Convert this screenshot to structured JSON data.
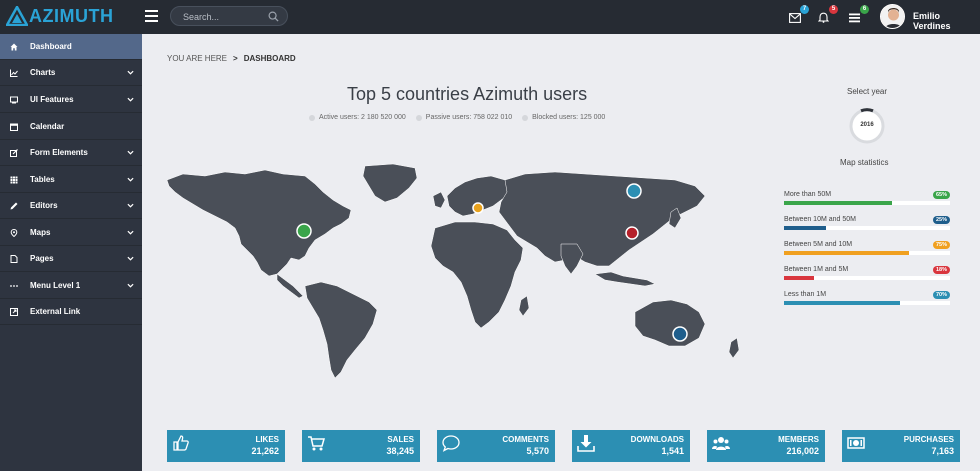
{
  "app": {
    "logo_text": "AZIMUTH"
  },
  "search": {
    "placeholder": "Search..."
  },
  "topbar": {
    "mail_badge": "7",
    "notif_badge": "5",
    "tasks_badge": "6",
    "user_name": "Emilio Verdines",
    "colors": {
      "mail": "#2aa3d6",
      "notif": "#d9363e",
      "tasks": "#3aa54a"
    }
  },
  "sidebar": {
    "items": [
      {
        "label": "Dashboard",
        "icon": "home-icon",
        "active": true,
        "has_children": false
      },
      {
        "label": "Charts",
        "icon": "chart-icon",
        "active": false,
        "has_children": true
      },
      {
        "label": "UI Features",
        "icon": "monitor-icon",
        "active": false,
        "has_children": true
      },
      {
        "label": "Calendar",
        "icon": "calendar-icon",
        "active": false,
        "has_children": false
      },
      {
        "label": "Form Elements",
        "icon": "edit-icon",
        "active": false,
        "has_children": true
      },
      {
        "label": "Tables",
        "icon": "grid-icon",
        "active": false,
        "has_children": true
      },
      {
        "label": "Editors",
        "icon": "pencil-icon",
        "active": false,
        "has_children": true
      },
      {
        "label": "Maps",
        "icon": "map-marker-icon",
        "active": false,
        "has_children": true
      },
      {
        "label": "Pages",
        "icon": "file-icon",
        "active": false,
        "has_children": true
      },
      {
        "label": "Menu Level 1",
        "icon": "ellipsis-icon",
        "active": false,
        "has_children": true
      },
      {
        "label": "External Link",
        "icon": "external-link-icon",
        "active": false,
        "has_children": false
      }
    ]
  },
  "breadcrumb": {
    "prefix": "YOU ARE HERE",
    "separator": ">",
    "current": "DASHBOARD"
  },
  "map": {
    "title": "Top 5 countries Azimuth users",
    "legend": [
      {
        "label": "Active users: 2 180 520 000"
      },
      {
        "label": "Passive users: 758 022 010"
      },
      {
        "label": "Blocked users: 125 000"
      }
    ],
    "markers": [
      {
        "region": "North America",
        "color": "#3aa54a"
      },
      {
        "region": "Europe",
        "color": "#e8a21e"
      },
      {
        "region": "Russia",
        "color": "#2c8fb3"
      },
      {
        "region": "China",
        "color": "#b5202a"
      },
      {
        "region": "Australia",
        "color": "#1f5e8c"
      }
    ]
  },
  "year": {
    "label": "Select year",
    "value": "2016"
  },
  "map_stats": {
    "title": "Map statistics",
    "rows": [
      {
        "label": "More than 50M",
        "percent": 65,
        "badge": "65%",
        "color": "#3aa54a"
      },
      {
        "label": "Between 10M and 50M",
        "percent": 25,
        "badge": "25%",
        "color": "#1f5e8c"
      },
      {
        "label": "Between 5M and 10M",
        "percent": 75,
        "badge": "75%",
        "color": "#f0a020"
      },
      {
        "label": "Between 1M and 5M",
        "percent": 18,
        "badge": "18%",
        "color": "#d9363e"
      },
      {
        "label": "Less than 1M",
        "percent": 70,
        "badge": "70%",
        "color": "#2c8fb3"
      }
    ]
  },
  "tiles": [
    {
      "label": "LIKES",
      "value": "21,262",
      "icon": "thumbs-up-icon"
    },
    {
      "label": "SALES",
      "value": "38,245",
      "icon": "cart-icon"
    },
    {
      "label": "COMMENTS",
      "value": "5,570",
      "icon": "comment-icon"
    },
    {
      "label": "DOWNLOADS",
      "value": "1,541",
      "icon": "download-icon"
    },
    {
      "label": "MEMBERS",
      "value": "216,002",
      "icon": "users-icon"
    },
    {
      "label": "PURCHASES",
      "value": "7,163",
      "icon": "money-icon"
    }
  ]
}
